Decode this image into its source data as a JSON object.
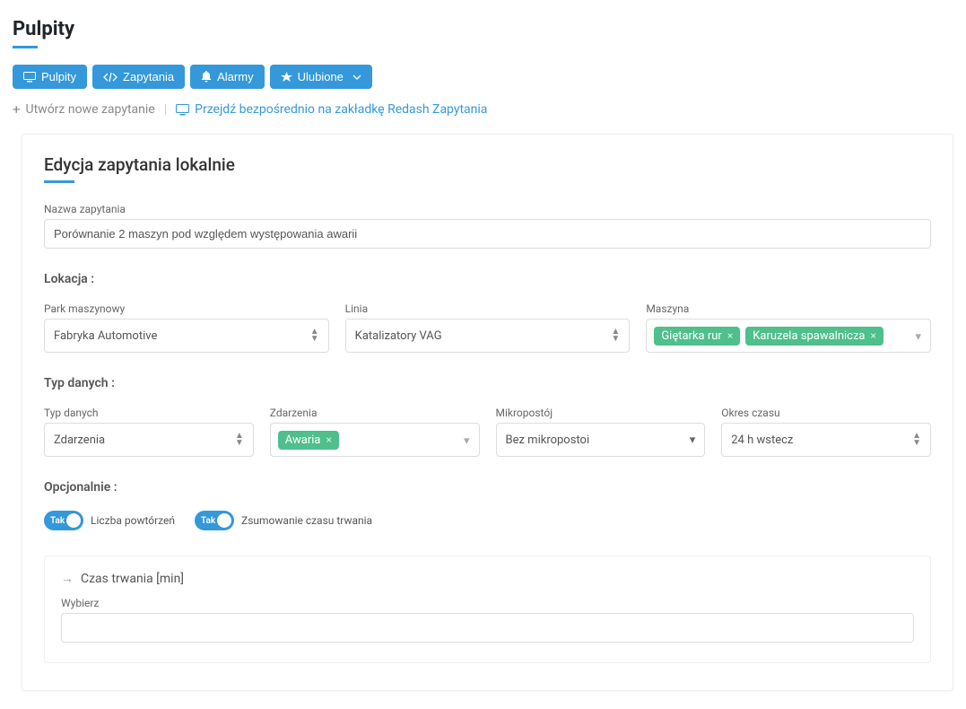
{
  "page": {
    "title": "Pulpity"
  },
  "tabs": {
    "pulpity": "Pulpity",
    "zapytania": "Zapytania",
    "alarmy": "Alarmy",
    "ulubione": "Ulubione"
  },
  "actions": {
    "create": "Utwórz nowe zapytanie",
    "redash": "Przejdź bezpośrednio na zakładkę Redash Zapytania"
  },
  "editor": {
    "title": "Edycja zapytania lokalnie",
    "nameLabel": "Nazwa zapytania",
    "nameValue": "Porównanie 2 maszyn pod względem występowania awarii",
    "sections": {
      "location": "Lokacja :",
      "dataType": "Typ danych :",
      "optional": "Opcjonalnie :"
    },
    "location": {
      "parkLabel": "Park maszynowy",
      "parkValue": "Fabryka Automotive",
      "lineLabel": "Linia",
      "lineValue": "Katalizatory VAG",
      "machineLabel": "Maszyna",
      "machines": [
        "Giętarka rur",
        "Karuzela spawalnicza"
      ]
    },
    "dataType": {
      "typeLabel": "Typ danych",
      "typeValue": "Zdarzenia",
      "eventsLabel": "Zdarzenia",
      "eventTags": [
        "Awaria"
      ],
      "microLabel": "Mikropostój",
      "microValue": "Bez mikropostoi",
      "periodLabel": "Okres czasu",
      "periodValue": "24 h wstecz"
    },
    "optional": {
      "toggle1Value": "Tak",
      "toggle1Label": "Liczba powtórzeń",
      "toggle2Value": "Tak",
      "toggle2Label": "Zsumowanie czasu trwania"
    },
    "duration": {
      "title": "Czas trwania [min]",
      "chooseLabel": "Wybierz"
    }
  }
}
